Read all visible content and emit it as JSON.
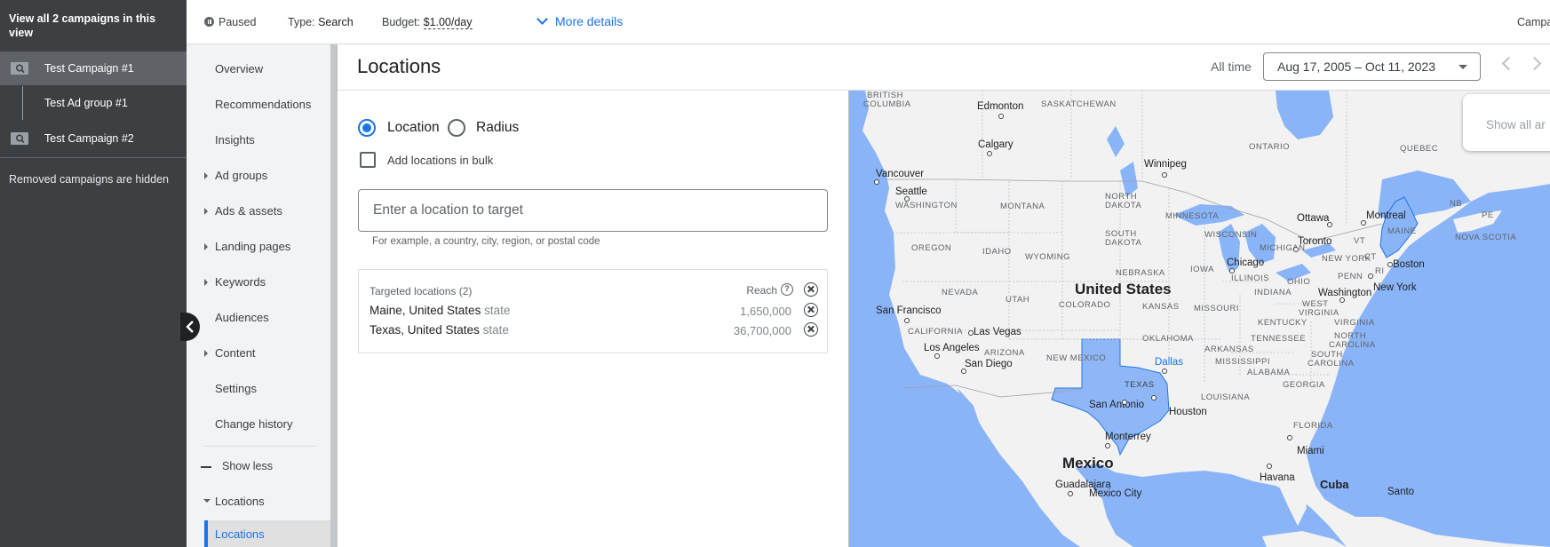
{
  "sidebar": {
    "view_all": "View all 2 campaigns in this view",
    "items": [
      {
        "label": "Test Campaign #1"
      },
      {
        "label": "Test Ad group #1"
      },
      {
        "label": "Test Campaign #2"
      }
    ],
    "removed_note": "Removed campaigns are hidden"
  },
  "topbar": {
    "status": "Paused",
    "type_label": "Type:",
    "type_value": "Search",
    "budget_label": "Budget:",
    "budget_value": "$1.00/day",
    "more_details": "More details",
    "right_cut": "Campa"
  },
  "page_nav": {
    "items": [
      "Overview",
      "Recommendations",
      "Insights",
      "Ad groups",
      "Ads & assets",
      "Landing pages",
      "Keywords",
      "Audiences",
      "Content",
      "Settings",
      "Change history"
    ],
    "show_less": "Show less",
    "section": "Locations",
    "active": "Locations"
  },
  "header": {
    "title": "Locations",
    "all_time": "All time",
    "date_range": "Aug 17, 2005 – Oct 11, 2023"
  },
  "form": {
    "radio_location": "Location",
    "radio_radius": "Radius",
    "bulk_label": "Add locations in bulk",
    "input_placeholder": "Enter a location to target",
    "hint": "For example, a country, city, region, or postal code",
    "targeted_head": "Targeted locations (2)",
    "reach_label": "Reach",
    "help_glyph": "?",
    "locations": [
      {
        "name": "Maine, United States",
        "type": "state",
        "reach": "1,650,000"
      },
      {
        "name": "Texas, United States",
        "type": "state",
        "reach": "36,700,000"
      }
    ]
  },
  "map": {
    "show_all": "Show all ar",
    "labels": {
      "british_columbia_1": "BRITISH",
      "british_columbia_2": "COLUMBIA",
      "edmonton": "Edmonton",
      "saskatchewan": "SASKATCHEWAN",
      "calgary": "Calgary",
      "ontario": "ONTARIO",
      "quebec": "QUEBEC",
      "winnipeg": "Winnipeg",
      "vancouver": "Vancouver",
      "seattle": "Seattle",
      "washington": "WASHINGTON",
      "montana": "MONTANA",
      "north_dakota_1": "NORTH",
      "north_dakota_2": "DAKOTA",
      "minnesota": "MINNESOTA",
      "ottawa": "Ottawa",
      "montreal": "Montreal",
      "nb": "NB",
      "pe": "PE",
      "maine": "MAINE",
      "south_dakota_1": "SOUTH",
      "south_dakota_2": "DAKOTA",
      "wisconsin": "WISCONSIN",
      "michigan": "MICHIGAN",
      "toronto": "Toronto",
      "vt": "VT",
      "nova_scotia": "NOVA SCOTIA",
      "oregon": "OREGON",
      "idaho": "IDAHO",
      "wyoming": "WYOMING",
      "new_york": "NEW YORK",
      "chicago": "Chicago",
      "ct": "CT",
      "ri": "RI",
      "boston": "Boston",
      "iowa": "IOWA",
      "nebraska": "NEBRASKA",
      "illinois": "ILLINOIS",
      "penn": "PENN",
      "ohio": "OHIO",
      "nevada": "NEVADA",
      "utah": "UTAH",
      "united_states": "United States",
      "indiana": "INDIANA",
      "washington_dc": "Washington",
      "new_york_city": "New York",
      "colorado": "COLORADO",
      "kansas": "KANSAS",
      "missouri": "MISSOURI",
      "west_virginia_1": "WEST",
      "west_virginia_2": "VIRGINIA",
      "san_francisco": "San Francisco",
      "virginia": "VIRGINIA",
      "california": "CALIFORNIA",
      "kentucky": "KENTUCKY",
      "las_vegas": "Las Vegas",
      "oklahoma": "OKLAHOMA",
      "north_carolina_1": "NORTH",
      "north_carolina_2": "CAROLINA",
      "tennessee": "TENNESSEE",
      "los_angeles": "Los Angeles",
      "arizona": "ARIZONA",
      "arkansas": "ARKANSAS",
      "south_carolina_1": "SOUTH",
      "san_diego": "San Diego",
      "new_mexico": "NEW MEXICO",
      "dallas": "Dallas",
      "mississippi": "MISSISSIPPI",
      "south_carolina_2": "CAROLINA",
      "alabama": "ALABAMA",
      "georgia": "GEORGIA",
      "texas": "TEXAS",
      "louisiana": "LOUISIANA",
      "san_antonio": "San Antonio",
      "houston": "Houston",
      "florida": "FLORIDA",
      "monterrey": "Monterrey",
      "miami": "Miami",
      "mexico": "Mexico",
      "havana": "Havana",
      "cuba": "Cuba",
      "guadalajara": "Guadalajara",
      "mexico_city": "Mexico City",
      "santo": "Santo"
    }
  },
  "colors": {
    "accent": "#1a73e8",
    "sidebar_bg": "#3c4043",
    "water": "#8ab4f8",
    "targeted_fill": "#8ab4f8"
  }
}
